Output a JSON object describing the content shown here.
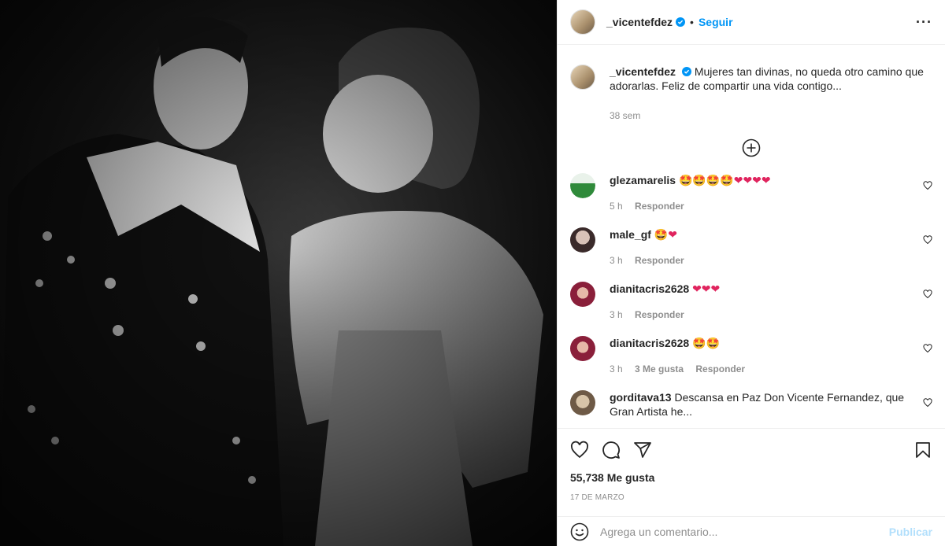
{
  "post": {
    "image_alt": "Fotografía en blanco y negro de una pareja"
  },
  "header": {
    "username": "_vicentefdez",
    "separator": "•",
    "follow_label": "Seguir",
    "more_label": "···"
  },
  "caption": {
    "username": "_vicentefdez",
    "text": "Mujeres tan divinas, no queda otro camino que adorarlas. Feliz de compartir una vida contigo...",
    "time": "38 sem"
  },
  "comments": [
    {
      "username": "glezamarelis",
      "text": "🤩🤩🤩🤩❤❤❤❤",
      "time": "5 h",
      "likes": "",
      "reply": "Responder"
    },
    {
      "username": "male_gf",
      "text": "🤩❤",
      "time": "3 h",
      "likes": "",
      "reply": "Responder"
    },
    {
      "username": "dianitacris2628",
      "text": "❤❤❤",
      "time": "3 h",
      "likes": "",
      "reply": "Responder"
    },
    {
      "username": "dianitacris2628",
      "text": "🤩🤩",
      "time": "3 h",
      "likes": "3 Me gusta",
      "reply": "Responder"
    },
    {
      "username": "gorditava13",
      "text": "Descansa en Paz Don Vicente Fernandez, que Gran Artista he...",
      "time": "",
      "likes": "",
      "reply": ""
    }
  ],
  "actions": {
    "likes": "55,738 Me gusta",
    "date": "17 DE MARZO"
  },
  "add_comment": {
    "placeholder": "Agrega un comentario...",
    "publish_label": "Publicar"
  },
  "colors": {
    "accent": "#0095f6",
    "publish_disabled": "#b2dffc",
    "meta": "#8e8e8e",
    "heart": "#e0245e"
  },
  "icons": [
    "verified-icon",
    "more-icon",
    "plus-circle-icon",
    "heart-icon",
    "comment-icon",
    "share-icon",
    "bookmark-icon",
    "emoji-icon"
  ]
}
